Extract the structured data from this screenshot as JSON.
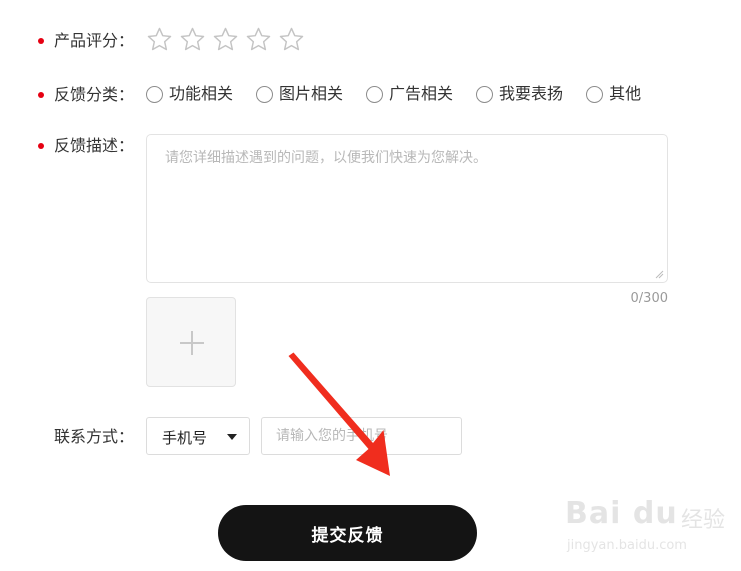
{
  "rating": {
    "label": "产品评分：",
    "max_stars": 5,
    "value": 0,
    "star_color": "#c4c4c4"
  },
  "category": {
    "label": "反馈分类：",
    "options": [
      {
        "label": "功能相关",
        "selected": false
      },
      {
        "label": "图片相关",
        "selected": false
      },
      {
        "label": "广告相关",
        "selected": false
      },
      {
        "label": "我要表扬",
        "selected": false
      },
      {
        "label": "其他",
        "selected": false
      }
    ]
  },
  "description": {
    "label": "反馈描述：",
    "placeholder": "请您详细描述遇到的问题，以便我们快速为您解决。",
    "value": "",
    "counter": "0/300"
  },
  "upload": {
    "icon": "plus-icon"
  },
  "contact": {
    "label": "联系方式：",
    "type_selected": "手机号",
    "placeholder": "请输入您的手机号",
    "value": ""
  },
  "submit": {
    "label": "提交反馈",
    "color": "#141414"
  },
  "required_color": "#e60012",
  "annotation": {
    "arrow_color": "#f02d1e",
    "icon": "red-arrow-icon"
  },
  "watermark": {
    "logo_text": "Bai du",
    "cn_text": "经验",
    "url": "jingyan.baidu.com"
  }
}
